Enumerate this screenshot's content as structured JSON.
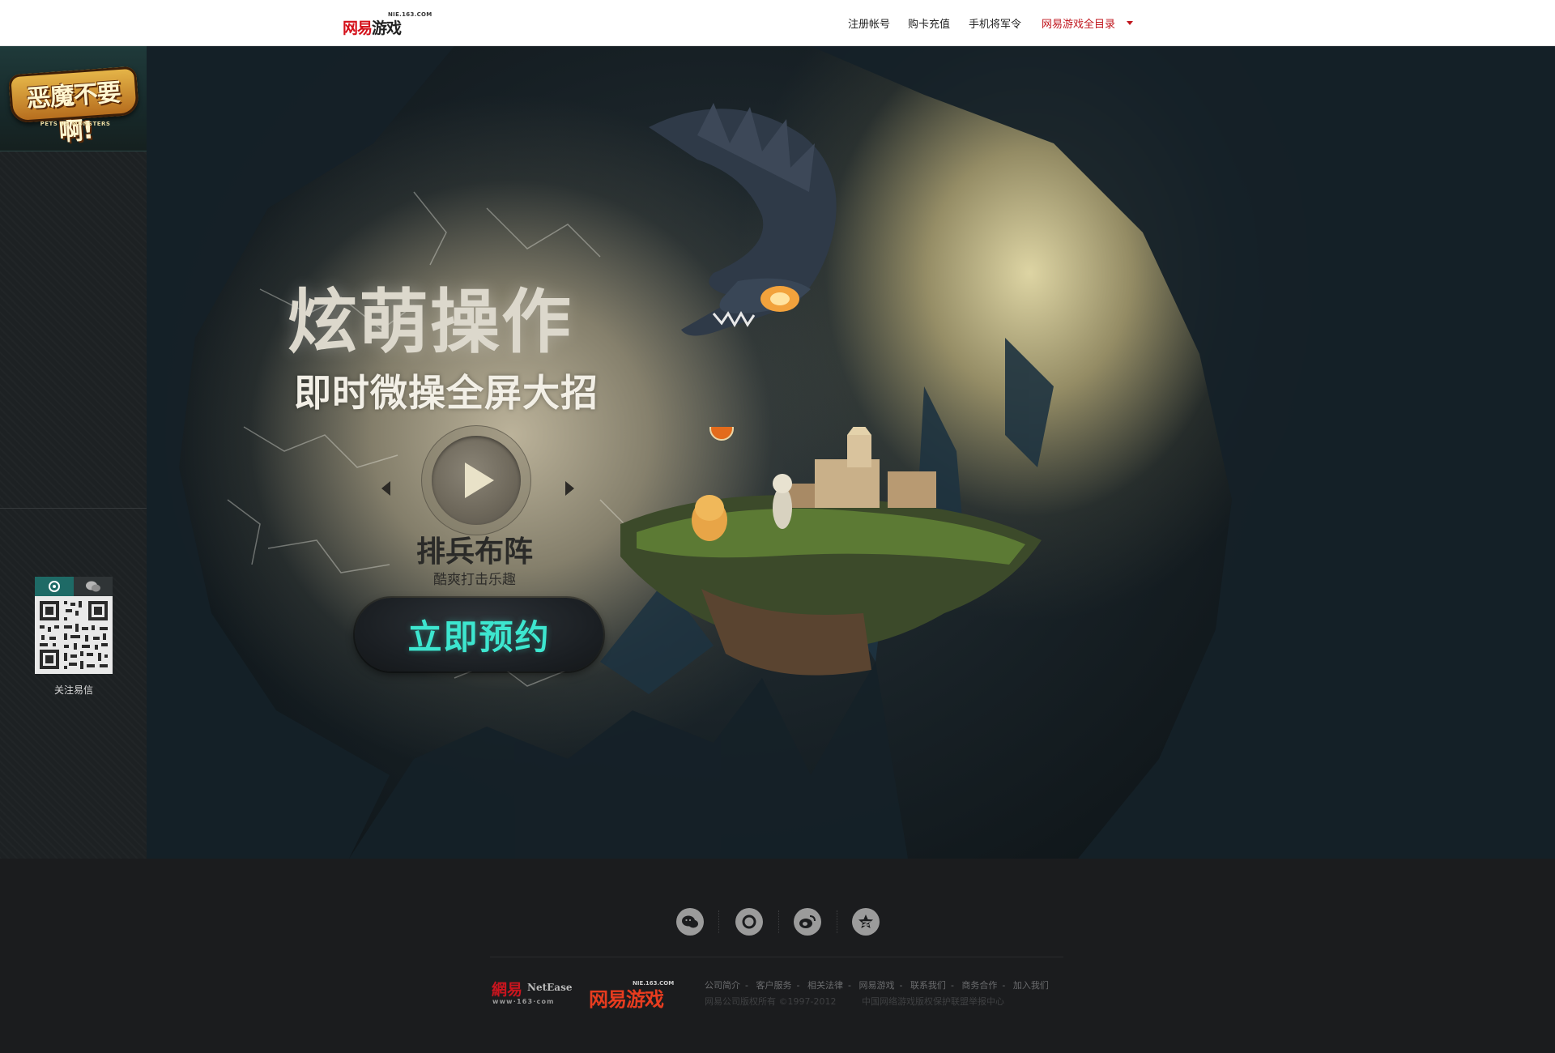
{
  "topbar": {
    "brand": {
      "mark": "网易",
      "mark_b": "游戏",
      "domain": "NIE.163.COM"
    },
    "nav": [
      {
        "label": "注册帐号"
      },
      {
        "label": "购卡充值"
      },
      {
        "label": "手机将军令"
      },
      {
        "label": "网易游戏全目录"
      }
    ]
  },
  "sidebar": {
    "logo_title": "恶魔不要啊!",
    "logo_sub": "PETS VS MONSTERS",
    "qr_caption": "关注易信"
  },
  "hero": {
    "headline": "炫萌操作",
    "subheadline": "即时微操全屏大招",
    "slide_title": "排兵布阵",
    "slide_sub": "酷爽打击乐趣",
    "cta_label": "立即预约"
  },
  "footer": {
    "netease_cn": "網易",
    "netease_en": "NetEase",
    "netease_url": "www·163·com",
    "game_logo": "网易游戏",
    "game_domain": "NIE.163.COM",
    "links": [
      "公司简介",
      "客户服务",
      "相关法律",
      "网易游戏",
      "联系我们",
      "商务合作",
      "加入我们"
    ],
    "copyright": "网易公司版权所有 ©1997-2012",
    "report": "中国网络游戏版权保护联盟举报中心",
    "social_icons": [
      "wechat-icon",
      "yixin-icon",
      "weibo-icon",
      "qzone-icon"
    ]
  },
  "colors": {
    "accent_red": "#c0161d",
    "cta_text": "#3de6cf",
    "qr_tab_active": "#1e6a66"
  }
}
